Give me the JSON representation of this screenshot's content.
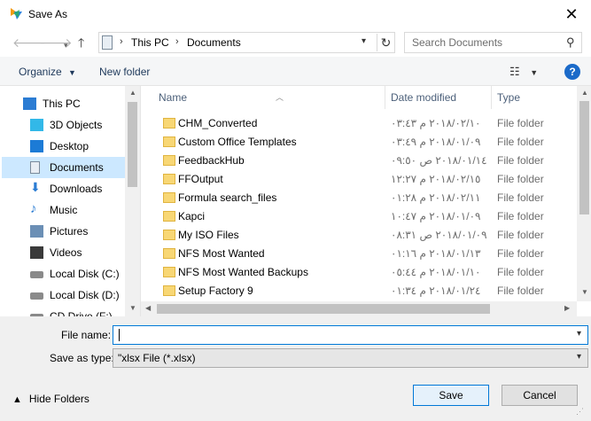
{
  "window": {
    "title": "Save As"
  },
  "nav": {
    "back_icon": "arrow-left-icon",
    "forward_icon": "arrow-right-icon",
    "recent_icon": "chevron-down-icon",
    "up_icon": "arrow-up-icon"
  },
  "address": {
    "items": [
      "This PC",
      "Documents"
    ]
  },
  "search": {
    "placeholder": "Search Documents"
  },
  "toolbar": {
    "organize_label": "Organize",
    "new_folder_label": "New folder",
    "help_label": "?"
  },
  "sidebar": {
    "items": [
      {
        "label": "This PC",
        "icon": "computer-icon",
        "color": "#2b7cd3"
      },
      {
        "label": "3D Objects",
        "icon": "cube-icon",
        "color": "#32b8e8"
      },
      {
        "label": "Desktop",
        "icon": "desktop-icon",
        "color": "#1c7bd6"
      },
      {
        "label": "Documents",
        "icon": "document-icon",
        "color": "#7a8a9a",
        "selected": true
      },
      {
        "label": "Downloads",
        "icon": "download-icon",
        "color": "#2b7cd3"
      },
      {
        "label": "Music",
        "icon": "music-icon",
        "color": "#2b7cd3"
      },
      {
        "label": "Pictures",
        "icon": "pictures-icon",
        "color": "#6b8fb5"
      },
      {
        "label": "Videos",
        "icon": "video-icon",
        "color": "#3a3a3a"
      },
      {
        "label": "Local Disk (C:)",
        "icon": "drive-icon",
        "color": "#8a8a8a"
      },
      {
        "label": "Local Disk (D:)",
        "icon": "drive-icon",
        "color": "#8a8a8a"
      },
      {
        "label": "CD Drive (F:)",
        "icon": "cd-drive-icon",
        "color": "#8a8a8a"
      }
    ]
  },
  "columns": {
    "name": "Name",
    "date": "Date modified",
    "type": "Type"
  },
  "files": [
    {
      "name": "CHM_Converted",
      "date": "٢٠١٨/٠٢/١٠ م ٠٣:٤٣",
      "type": "File folder"
    },
    {
      "name": "Custom Office Templates",
      "date": "٢٠١٨/٠١/٠٩ م ٠٣:٤٩",
      "type": "File folder"
    },
    {
      "name": "FeedbackHub",
      "date": "٢٠١٨/٠١/١٤ ص ٠٩:٥٠",
      "type": "File folder"
    },
    {
      "name": "FFOutput",
      "date": "٢٠١٨/٠٢/١٥ م ١٢:٢٧",
      "type": "File folder"
    },
    {
      "name": "Formula search_files",
      "date": "٢٠١٨/٠٢/١١ م ٠١:٢٨",
      "type": "File folder"
    },
    {
      "name": "Kapci",
      "date": "٢٠١٨/٠١/٠٩ م ١٠:٤٧",
      "type": "File folder"
    },
    {
      "name": "My ISO Files",
      "date": "٢٠١٨/٠١/٠٩ ص ٠٨:٣١",
      "type": "File folder"
    },
    {
      "name": "NFS Most Wanted",
      "date": "٢٠١٨/٠١/١٣ م ٠١:١٦",
      "type": "File folder"
    },
    {
      "name": "NFS Most Wanted Backups",
      "date": "٢٠١٨/٠١/١٠ م ٠٥:٤٤",
      "type": "File folder"
    },
    {
      "name": "Setup Factory 9",
      "date": "٢٠١٨/٠١/٢٤ م ٠١:٣٤",
      "type": "File folder"
    }
  ],
  "form": {
    "file_name_label": "File name:",
    "file_name_value": "",
    "save_as_type_label": "Save as type:",
    "save_as_type_value": "\"xlsx File (*.xlsx)"
  },
  "footer": {
    "hide_folders_label": "Hide Folders",
    "save_label": "Save",
    "cancel_label": "Cancel"
  },
  "colors": {
    "accent": "#0078d7",
    "selected_bg": "#cce8ff",
    "folder": "#f8d775"
  }
}
